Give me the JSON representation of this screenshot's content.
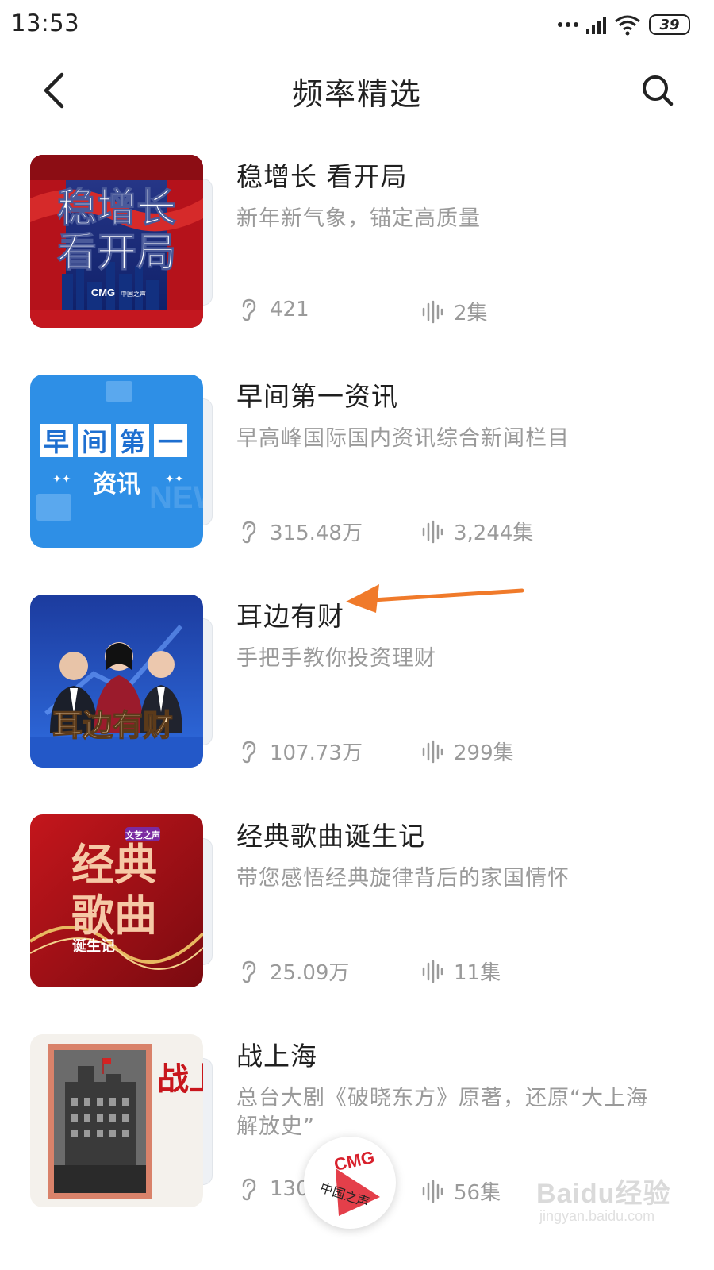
{
  "status_bar": {
    "time": "13:53",
    "battery": "39"
  },
  "header": {
    "title": "频率精选"
  },
  "icons": {
    "back": "chevron-left-icon",
    "search": "search-icon",
    "plays": "ear-icon",
    "episodes": "soundwave-icon"
  },
  "programs": [
    {
      "title": "稳增长 看开局",
      "desc": "新年新气象，锚定高质量",
      "plays": "421",
      "episodes": "2集",
      "cover_text_1": "稳增长",
      "cover_text_2": "看开局",
      "cover_logo": "CMG",
      "cover_logo_sub": "中国之声"
    },
    {
      "title": "早间第一资讯",
      "desc": "早高峰国际国内资讯综合新闻栏目",
      "plays": "315.48万",
      "episodes": "3,244集",
      "cover_chars": [
        "早",
        "间",
        "第",
        "一"
      ],
      "cover_text_2": "资讯",
      "cover_bg_text": "NEWS"
    },
    {
      "title": "耳边有财",
      "desc": "手把手教你投资理财",
      "plays": "107.73万",
      "episodes": "299集",
      "cover_text": "耳边有财"
    },
    {
      "title": "经典歌曲诞生记",
      "desc": "带您感悟经典旋律背后的家国情怀",
      "plays": "25.09万",
      "episodes": "11集",
      "cover_text_1": "经典",
      "cover_text_2": "歌曲",
      "cover_text_3": "诞生记",
      "cover_badge": "文艺之声"
    },
    {
      "title": "战上海",
      "desc": "总台大剧《破晓东方》原著，还原“大上海解放史”",
      "plays": "130",
      "episodes": "56集",
      "cover_text": "战上海"
    }
  ],
  "player": {
    "brand": "CMG",
    "label": "中国之声"
  },
  "watermark": {
    "logo": "Baidu经验",
    "url": "jingyan.baidu.com"
  },
  "colors": {
    "accent_arrow": "#f07a2a",
    "meta_gray": "#9a9a9a",
    "brand_red": "#d8202c"
  }
}
